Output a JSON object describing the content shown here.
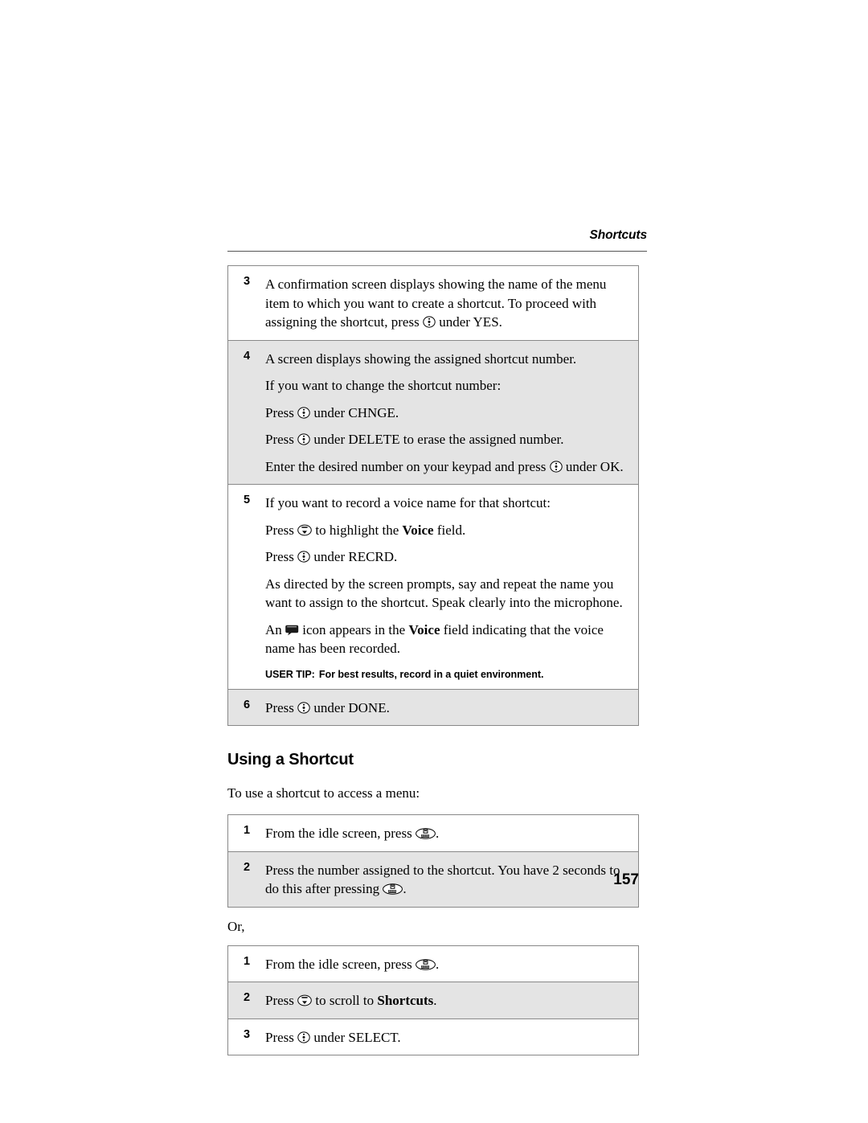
{
  "header": {
    "running_title": "Shortcuts"
  },
  "page_number": "157",
  "icons": {
    "select_key": "center-select-key-icon",
    "scroll_key": "scroll-down-key-icon",
    "menu_key": "menu-key-icon",
    "voice_name": "voice-name-icon"
  },
  "table1": {
    "rows": [
      {
        "number": "3",
        "paragraphs": [
          {
            "parts": [
              {
                "t": "text",
                "v": "A confirmation screen displays showing the name of the menu item to which you want to create a shortcut. To proceed with assigning the shortcut, press "
              },
              {
                "t": "icon",
                "v": "select_key"
              },
              {
                "t": "text",
                "v": " under YES."
              }
            ]
          }
        ]
      },
      {
        "number": "4",
        "paragraphs": [
          {
            "parts": [
              {
                "t": "text",
                "v": "A screen displays showing the assigned shortcut number."
              }
            ]
          },
          {
            "parts": [
              {
                "t": "text",
                "v": "If you want to change the shortcut number:"
              }
            ]
          },
          {
            "parts": [
              {
                "t": "text",
                "v": "Press "
              },
              {
                "t": "icon",
                "v": "select_key"
              },
              {
                "t": "text",
                "v": " under CHNGE."
              }
            ]
          },
          {
            "parts": [
              {
                "t": "text",
                "v": "Press "
              },
              {
                "t": "icon",
                "v": "select_key"
              },
              {
                "t": "text",
                "v": " under DELETE to erase the assigned number."
              }
            ]
          },
          {
            "parts": [
              {
                "t": "text",
                "v": "Enter the desired number on your keypad and press "
              },
              {
                "t": "icon",
                "v": "select_key"
              },
              {
                "t": "text",
                "v": " under OK."
              }
            ]
          }
        ]
      },
      {
        "number": "5",
        "paragraphs": [
          {
            "parts": [
              {
                "t": "text",
                "v": "If you want to record a voice name for that shortcut:"
              }
            ]
          },
          {
            "parts": [
              {
                "t": "text",
                "v": "Press "
              },
              {
                "t": "icon",
                "v": "scroll_key"
              },
              {
                "t": "text",
                "v": " to highlight the "
              },
              {
                "t": "bold",
                "v": "Voice"
              },
              {
                "t": "text",
                "v": " field."
              }
            ]
          },
          {
            "parts": [
              {
                "t": "text",
                "v": "Press "
              },
              {
                "t": "icon",
                "v": "select_key"
              },
              {
                "t": "text",
                "v": " under RECRD."
              }
            ]
          },
          {
            "parts": [
              {
                "t": "text",
                "v": "As directed by the screen prompts, say and repeat the name you want to assign to the shortcut. Speak clearly into the microphone."
              }
            ]
          },
          {
            "parts": [
              {
                "t": "text",
                "v": "An "
              },
              {
                "t": "icon",
                "v": "voice_name"
              },
              {
                "t": "text",
                "v": " icon appears in the "
              },
              {
                "t": "bold",
                "v": "Voice"
              },
              {
                "t": "text",
                "v": " field indicating that the voice name has been recorded."
              }
            ]
          }
        ],
        "user_tip": {
          "label": "USER TIP:",
          "text": "For best results, record in a quiet environment."
        }
      },
      {
        "number": "6",
        "paragraphs": [
          {
            "parts": [
              {
                "t": "text",
                "v": "Press "
              },
              {
                "t": "icon",
                "v": "select_key"
              },
              {
                "t": "text",
                "v": " under DONE."
              }
            ]
          }
        ]
      }
    ]
  },
  "section": {
    "heading": "Using a Shortcut",
    "lead": "To use a shortcut to access a menu:",
    "or": "Or,"
  },
  "table2": {
    "rows": [
      {
        "number": "1",
        "paragraphs": [
          {
            "parts": [
              {
                "t": "text",
                "v": "From the idle screen, press "
              },
              {
                "t": "icon",
                "v": "menu_key"
              },
              {
                "t": "text",
                "v": "."
              }
            ]
          }
        ]
      },
      {
        "number": "2",
        "paragraphs": [
          {
            "parts": [
              {
                "t": "text",
                "v": "Press the number assigned to the shortcut. You have 2 seconds to do this after pressing "
              },
              {
                "t": "icon",
                "v": "menu_key"
              },
              {
                "t": "text",
                "v": "."
              }
            ]
          }
        ]
      }
    ]
  },
  "table3": {
    "rows": [
      {
        "number": "1",
        "paragraphs": [
          {
            "parts": [
              {
                "t": "text",
                "v": "From the idle screen, press "
              },
              {
                "t": "icon",
                "v": "menu_key"
              },
              {
                "t": "text",
                "v": "."
              }
            ]
          }
        ]
      },
      {
        "number": "2",
        "paragraphs": [
          {
            "parts": [
              {
                "t": "text",
                "v": "Press "
              },
              {
                "t": "icon",
                "v": "scroll_key"
              },
              {
                "t": "text",
                "v": " to scroll to "
              },
              {
                "t": "bold",
                "v": "Shortcuts"
              },
              {
                "t": "text",
                "v": "."
              }
            ]
          }
        ]
      },
      {
        "number": "3",
        "paragraphs": [
          {
            "parts": [
              {
                "t": "text",
                "v": "Press "
              },
              {
                "t": "icon",
                "v": "select_key"
              },
              {
                "t": "text",
                "v": " under SELECT."
              }
            ]
          }
        ]
      }
    ]
  }
}
